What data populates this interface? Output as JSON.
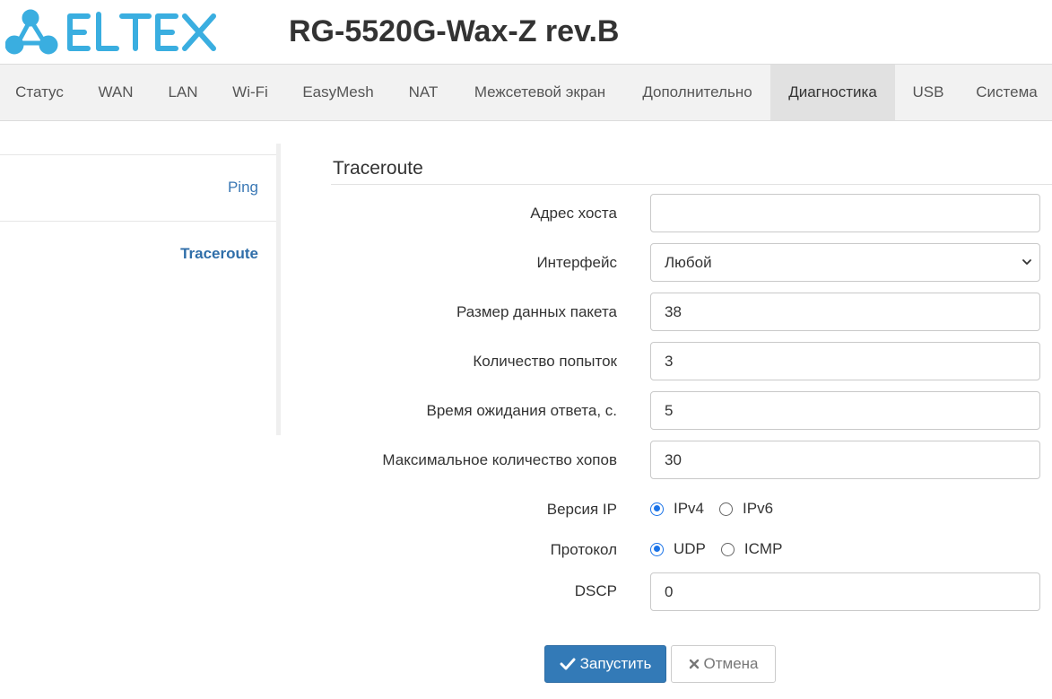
{
  "brand": {
    "logo_text": "ELTEX",
    "logo_color": "#3aaee0",
    "model": "RG-5520G-Wax-Z rev.B"
  },
  "nav": {
    "items": [
      "Статус",
      "WAN",
      "LAN",
      "Wi-Fi",
      "EasyMesh",
      "NAT",
      "Межсетевой экран",
      "Дополнительно",
      "Диагностика",
      "USB",
      "Система"
    ],
    "active": "Диагностика"
  },
  "sidebar": {
    "items": [
      "Ping",
      "Traceroute"
    ],
    "active": "Traceroute"
  },
  "form": {
    "title": "Traceroute",
    "host": {
      "label": "Адрес хоста",
      "value": ""
    },
    "interface": {
      "label": "Интерфейс",
      "value": "Любой"
    },
    "packet_size": {
      "label": "Размер данных пакета",
      "value": "38"
    },
    "attempts": {
      "label": "Количество попыток",
      "value": "3"
    },
    "timeout": {
      "label": "Время ожидания ответа, с.",
      "value": "5"
    },
    "max_hops": {
      "label": "Максимальное количество хопов",
      "value": "30"
    },
    "ip_version": {
      "label": "Версия IP",
      "options": [
        "IPv4",
        "IPv6"
      ],
      "selected": "IPv4"
    },
    "protocol": {
      "label": "Протокол",
      "options": [
        "UDP",
        "ICMP"
      ],
      "selected": "UDP"
    },
    "dscp": {
      "label": "DSCP",
      "value": "0"
    }
  },
  "buttons": {
    "start": "Запустить",
    "cancel": "Отмена"
  },
  "colors": {
    "primary_button": "#337ab7",
    "link": "#3a78b5",
    "radio_checked": "#1a73e8"
  }
}
